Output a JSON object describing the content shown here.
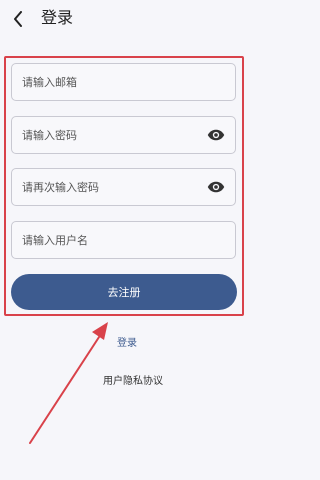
{
  "header": {
    "title": "登录",
    "back_icon": "chevron-left-icon"
  },
  "form": {
    "email_placeholder": "请输入邮箱",
    "password_placeholder": "请输入密码",
    "confirm_password_placeholder": "请再次输入密码",
    "username_placeholder": "请输入用户名",
    "email_value": "",
    "password_value": "",
    "confirm_password_value": "",
    "username_value": "",
    "eye_icon": "eye-icon"
  },
  "actions": {
    "register_label": "去注册",
    "login_link": "登录",
    "privacy_link": "用户隐私协议"
  },
  "annotation": {
    "highlight_color": "#d9424a",
    "arrow_color": "#d9424a"
  },
  "colors": {
    "accent": "#3d5b8f",
    "background": "#f6f6fa"
  }
}
